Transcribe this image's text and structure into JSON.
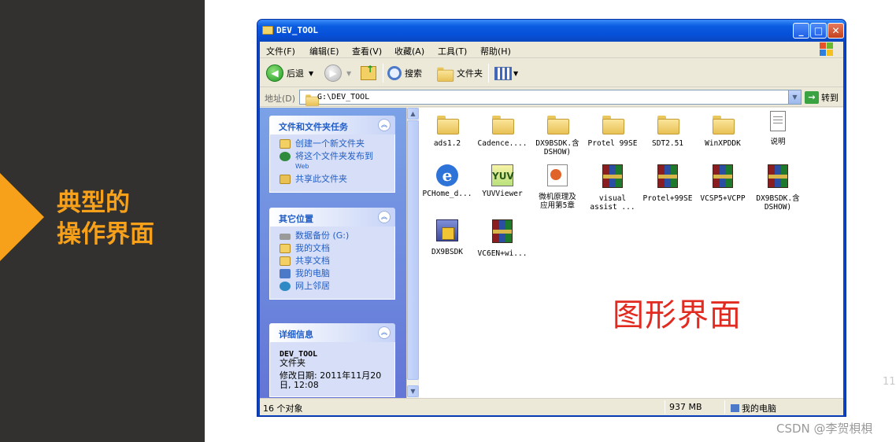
{
  "slide": {
    "title_line1": "典型的",
    "title_line2": "操作界面",
    "overlay_text": "图形界面",
    "page_number": "11",
    "watermark": "CSDN @李贺梖梖",
    "accent_color": "#f7a11a"
  },
  "window": {
    "title": "DEV_TOOL",
    "controls": {
      "minimize": "_",
      "maximize": "□",
      "close": "✕"
    }
  },
  "menu": {
    "items": [
      "文件(F)",
      "编辑(E)",
      "查看(V)",
      "收藏(A)",
      "工具(T)",
      "帮助(H)"
    ]
  },
  "toolbar": {
    "back_label": "后退",
    "search_label": "搜索",
    "folders_label": "文件夹"
  },
  "address": {
    "label": "地址(D)",
    "path": "G:\\DEV_TOOL",
    "go_label": "转到"
  },
  "taskpane": {
    "file_tasks": {
      "title": "文件和文件夹任务",
      "links": [
        {
          "text": "创建一个新文件夹",
          "icon": "new-folder-icon"
        },
        {
          "text": "将这个文件夹发布到",
          "sub": "Web",
          "icon": "publish-web-icon"
        },
        {
          "text": "共享此文件夹",
          "icon": "share-folder-icon"
        }
      ]
    },
    "other_places": {
      "title": "其它位置",
      "links": [
        {
          "text": "数据备份 (G:)",
          "icon": "drive-icon"
        },
        {
          "text": "我的文档",
          "icon": "my-documents-icon"
        },
        {
          "text": "共享文档",
          "icon": "shared-documents-icon"
        },
        {
          "text": "我的电脑",
          "icon": "my-computer-icon"
        },
        {
          "text": "网上邻居",
          "icon": "network-places-icon"
        }
      ]
    },
    "details": {
      "title": "详细信息",
      "name": "DEV_TOOL",
      "type": "文件夹",
      "modified_line1": "修改日期: 2011年11月20",
      "modified_line2": "日, 12:08"
    }
  },
  "files": [
    {
      "name": "ads1.2",
      "icon": "folder-icon"
    },
    {
      "name": "Cadence....",
      "icon": "folder-icon"
    },
    {
      "name": "DX9BSDK.含\nDSHOW)",
      "icon": "folder-icon"
    },
    {
      "name": "Protel 99SE",
      "icon": "folder-icon"
    },
    {
      "name": "SDT2.51",
      "icon": "folder-icon"
    },
    {
      "name": "WinXPDDK",
      "icon": "folder-icon"
    },
    {
      "name": "说明",
      "icon": "text-document-icon"
    },
    {
      "name": "PCHome_d...",
      "icon": "ie-html-icon"
    },
    {
      "name": "YUVViewer",
      "icon": "yuvviewer-app-icon"
    },
    {
      "name": "微机原理及\n应用第5章",
      "icon": "powerpoint-icon"
    },
    {
      "name": "visual\nassist ...",
      "icon": "winrar-archive-icon"
    },
    {
      "name": "Protel+99SE",
      "icon": "winrar-archive-icon"
    },
    {
      "name": "VCSP5+VCPP",
      "icon": "winrar-archive-icon"
    },
    {
      "name": "DX9BSDK.含\nDSHOW)",
      "icon": "winrar-archive-icon"
    },
    {
      "name": "DX9BSDK",
      "icon": "setup-installer-icon"
    },
    {
      "name": "VC6EN+wi...",
      "icon": "winrar-archive-icon"
    }
  ],
  "status": {
    "object_count": "16 个对象",
    "size": "937 MB",
    "location": "我的电脑"
  }
}
